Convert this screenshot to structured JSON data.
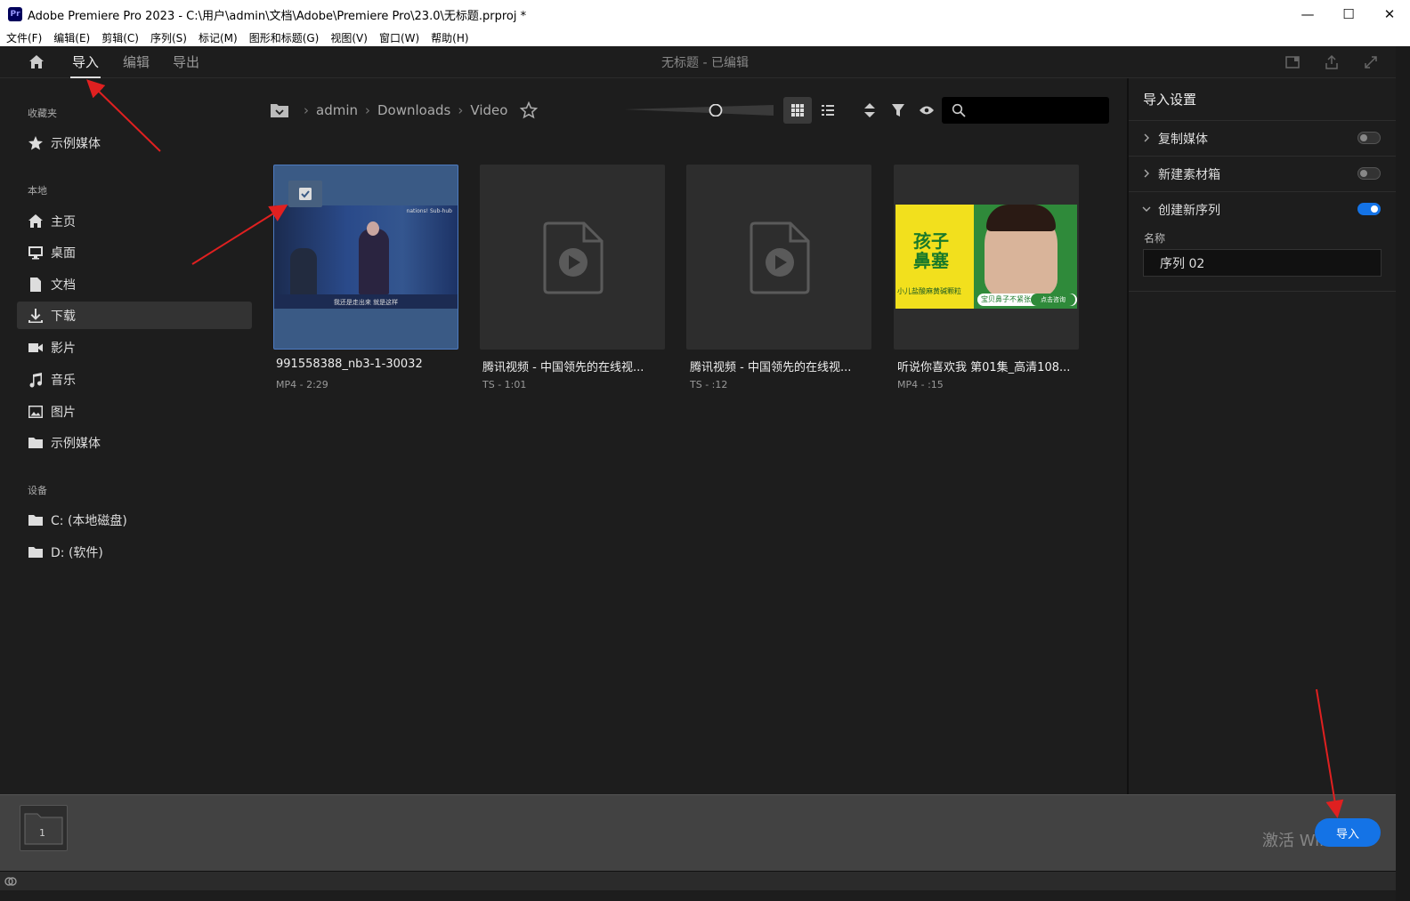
{
  "window": {
    "title": "Adobe Premiere Pro 2023 - C:\\用户\\admin\\文档\\Adobe\\Premiere Pro\\23.0\\无标题.prproj *",
    "app_icon_text": "Pr",
    "minimize": "—",
    "maximize": "☐",
    "close": "✕"
  },
  "menu": [
    "文件(F)",
    "编辑(E)",
    "剪辑(C)",
    "序列(S)",
    "标记(M)",
    "图形和标题(G)",
    "视图(V)",
    "窗口(W)",
    "帮助(H)"
  ],
  "topnav": {
    "tabs": [
      "导入",
      "编辑",
      "导出"
    ],
    "active_tab": "导入",
    "doc_title": "无标题 - 已编辑"
  },
  "sidebar": {
    "favorites_header": "收藏夹",
    "favorites": [
      {
        "label": "示例媒体",
        "icon": "star-icon"
      }
    ],
    "local_header": "本地",
    "local": [
      {
        "label": "主页",
        "icon": "home-icon"
      },
      {
        "label": "桌面",
        "icon": "desktop-icon"
      },
      {
        "label": "文档",
        "icon": "document-icon"
      },
      {
        "label": "下载",
        "icon": "download-icon"
      },
      {
        "label": "影片",
        "icon": "video-camera-icon"
      },
      {
        "label": "音乐",
        "icon": "music-note-icon"
      },
      {
        "label": "图片",
        "icon": "picture-icon"
      },
      {
        "label": "示例媒体",
        "icon": "folder-icon"
      }
    ],
    "active_local": "下载",
    "devices_header": "设备",
    "devices": [
      {
        "label": "C: (本地磁盘)",
        "icon": "folder-icon"
      },
      {
        "label": "D: (软件)",
        "icon": "folder-icon"
      }
    ]
  },
  "breadcrumb": [
    "admin",
    "Downloads",
    "Video"
  ],
  "media": [
    {
      "name": "991558388_nb3-1-30032",
      "meta": "MP4 - 2:29",
      "selected": true,
      "thumb": "video-frame"
    },
    {
      "name": "腾讯视频 - 中国领先的在线视...",
      "meta": "TS - 1:01",
      "selected": false,
      "thumb": "placeholder"
    },
    {
      "name": "腾讯视频 - 中国领先的在线视...",
      "meta": "TS - :12",
      "selected": false,
      "thumb": "placeholder"
    },
    {
      "name": "听说你喜欢我 第01集_高清108...",
      "meta": "MP4 - :15",
      "selected": false,
      "thumb": "ad-frame"
    }
  ],
  "thumb_text": {
    "video_corner": "nations! Sub-hub",
    "video_subtitle": "我还是走出来  就是这样",
    "ad_headline_1": "孩子",
    "ad_headline_2": "鼻塞",
    "ad_line": "小儿盐酸麻黄碱颗粒",
    "ad_button": "点击咨询",
    "ad_slogan": "宝贝鼻子不紧张"
  },
  "import_settings": {
    "title": "导入设置",
    "rows": [
      {
        "label": "复制媒体",
        "on": false,
        "expanded": false
      },
      {
        "label": "新建素材箱",
        "on": false,
        "expanded": false
      },
      {
        "label": "创建新序列",
        "on": true,
        "expanded": true
      }
    ],
    "name_label": "名称",
    "name_value": "序列 02"
  },
  "tray": {
    "count": "1",
    "import_button": "导入",
    "watermark": "激活 Windows"
  },
  "colors": {
    "accent": "#1473e6",
    "selected_card": "#3a5a85",
    "annotation_arrow": "#e02020"
  }
}
